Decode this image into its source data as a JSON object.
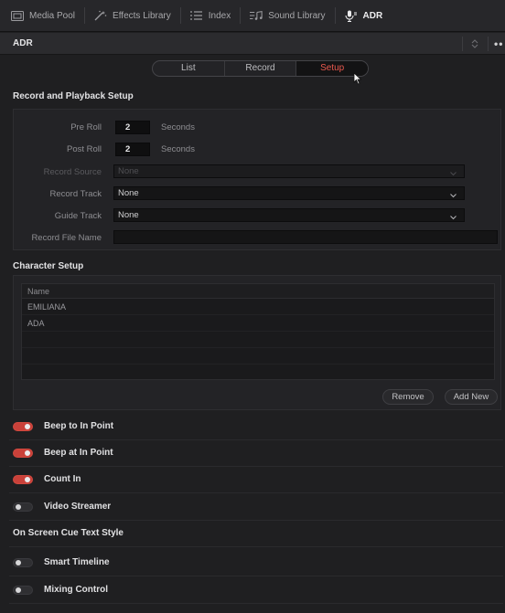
{
  "toolbar": {
    "items": [
      {
        "label": "Media Pool",
        "icon": "media-pool-icon"
      },
      {
        "label": "Effects Library",
        "icon": "effects-library-icon"
      },
      {
        "label": "Index",
        "icon": "index-icon"
      },
      {
        "label": "Sound Library",
        "icon": "sound-library-icon"
      },
      {
        "label": "ADR",
        "icon": "adr-microphone-icon",
        "active": true
      }
    ]
  },
  "panel": {
    "title": "ADR",
    "more_label": "••"
  },
  "tabs": [
    {
      "label": "List"
    },
    {
      "label": "Record"
    },
    {
      "label": "Setup",
      "active": true
    }
  ],
  "record_playback": {
    "title": "Record and Playback Setup",
    "pre_roll": {
      "label": "Pre Roll",
      "value": "2",
      "unit": "Seconds"
    },
    "post_roll": {
      "label": "Post Roll",
      "value": "2",
      "unit": "Seconds"
    },
    "record_source": {
      "label": "Record Source",
      "value": "None"
    },
    "record_track": {
      "label": "Record Track",
      "value": "None"
    },
    "guide_track": {
      "label": "Guide Track",
      "value": "None"
    },
    "record_file_name": {
      "label": "Record File Name",
      "value": ""
    }
  },
  "character_setup": {
    "title": "Character Setup",
    "column_header": "Name",
    "rows": [
      "EMILIANA",
      "ADA"
    ],
    "remove_label": "Remove",
    "add_new_label": "Add New"
  },
  "toggles": [
    {
      "label": "Beep to In Point",
      "on": true
    },
    {
      "label": "Beep at In Point",
      "on": true
    },
    {
      "label": "Count In",
      "on": true
    },
    {
      "label": "Video Streamer",
      "on": false
    }
  ],
  "cue_text": {
    "title": "On Screen Cue Text Style"
  },
  "toggles2": [
    {
      "label": "Smart Timeline",
      "on": false
    },
    {
      "label": "Mixing Control",
      "on": false
    }
  ],
  "colors": {
    "accent": "#e9594e",
    "toggle_on": "#c9413a",
    "background": "#1f1f21"
  }
}
